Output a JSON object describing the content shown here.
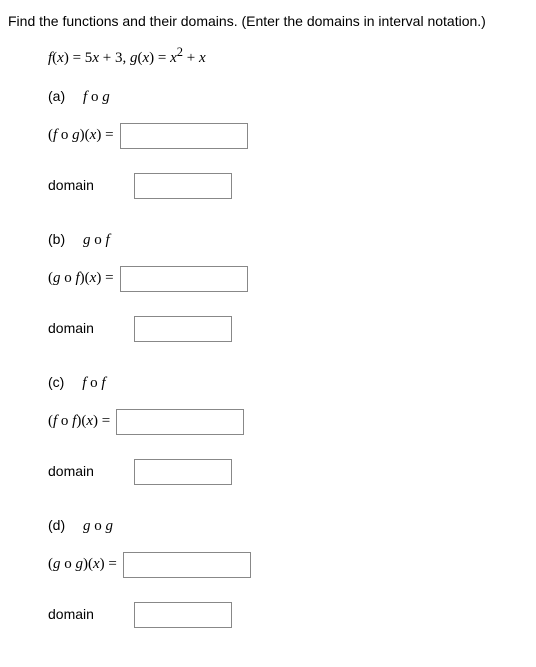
{
  "prompt": "Find the functions and their domains. (Enter the domains in interval notation.)",
  "functions_html": "f(x) = 5x + 3, g(x) = x² + x",
  "parts": {
    "a": {
      "label": "(a)",
      "comp": "f o g",
      "expr_prefix": "(f o g)(x) =",
      "domain_label": "domain",
      "expr_value": "",
      "domain_value": ""
    },
    "b": {
      "label": "(b)",
      "comp": "g o f",
      "expr_prefix": "(g o f)(x) =",
      "domain_label": "domain",
      "expr_value": "",
      "domain_value": ""
    },
    "c": {
      "label": "(c)",
      "comp": "f o f",
      "expr_prefix": "(f o f)(x) =",
      "domain_label": "domain",
      "expr_value": "",
      "domain_value": ""
    },
    "d": {
      "label": "(d)",
      "comp": "g o g",
      "expr_prefix": "(g o g)(x) =",
      "domain_label": "domain",
      "expr_value": "",
      "domain_value": ""
    }
  }
}
